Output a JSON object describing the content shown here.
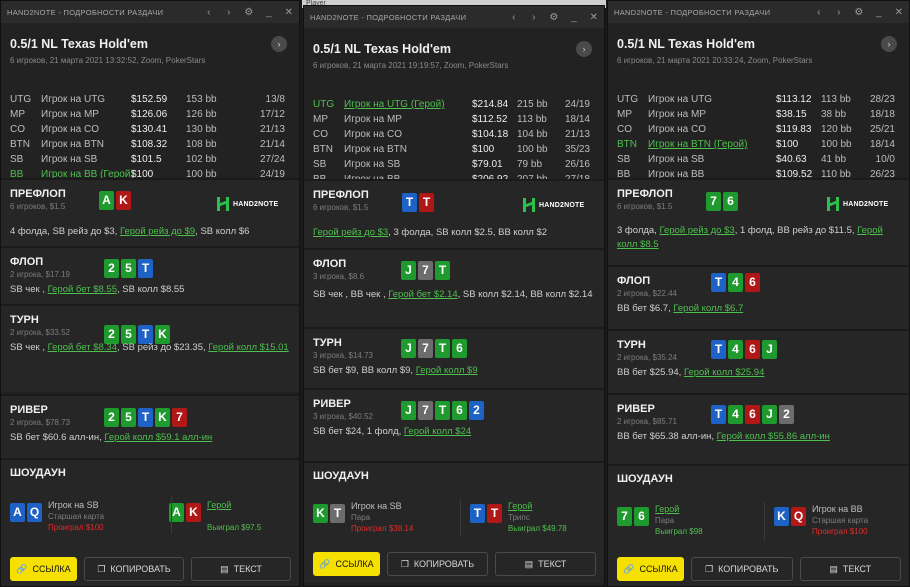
{
  "background_strip": {
    "text": "Player"
  },
  "common": {
    "window_title": "HAND2NOTE - ПОДРОБНОСТИ РАЗДАЧИ",
    "game_title": "0.5/1 NL Texas Hold'em",
    "logo_text": "HAND2NOTE",
    "showdown_title": "ШОУДАУН",
    "btn_link": "ССЫЛКА",
    "btn_copy": "КОПИРОВАТЬ",
    "btn_text": "ТЕКСТ"
  },
  "windows": [
    {
      "subtitle": "6 игроков, 21 марта 2021 13:32:52, Zoom, PokerStars",
      "players": [
        {
          "pos": "UTG",
          "name": "Игрок на UTG",
          "stack": "$152.59",
          "bb": "153 bb",
          "ratio": "13/8",
          "hero": false
        },
        {
          "pos": "MP",
          "name": "Игрок на MP",
          "stack": "$126.06",
          "bb": "126 bb",
          "ratio": "17/12",
          "hero": false
        },
        {
          "pos": "CO",
          "name": "Игрок на CO",
          "stack": "$130.41",
          "bb": "130 bb",
          "ratio": "21/13",
          "hero": false
        },
        {
          "pos": "BTN",
          "name": "Игрок на BTN",
          "stack": "$108.32",
          "bb": "108 bb",
          "ratio": "21/14",
          "hero": false
        },
        {
          "pos": "SB",
          "name": "Игрок на SB",
          "stack": "$101.5",
          "bb": "102 bb",
          "ratio": "27/24",
          "hero": false
        },
        {
          "pos": "BB",
          "name": "Игрок на BB (Герой)",
          "stack": "$100",
          "bb": "100 bb",
          "ratio": "24/19",
          "hero": true
        }
      ],
      "streets": [
        {
          "name": "ПРЕФЛОП",
          "info": "6 игроков, $1.5",
          "cards": [
            [
              "A",
              "g"
            ],
            [
              "K",
              "r"
            ]
          ],
          "actions": [
            [
              "4 фолда, SB рейз до $3, ",
              false
            ],
            [
              "Герой рейз до $9",
              true
            ],
            [
              ", SB колл $6",
              false
            ]
          ]
        },
        {
          "name": "ФЛОП",
          "info": "2 игрока, $17.19",
          "cards": [
            [
              "2",
              "g"
            ],
            [
              "5",
              "g"
            ],
            [
              "T",
              "b"
            ]
          ],
          "actions": [
            [
              "SB чек , ",
              false
            ],
            [
              "Герой бет $8.55",
              true
            ],
            [
              ", SB колл $8.55",
              false
            ]
          ]
        },
        {
          "name": "ТУРН",
          "info": "2 игрока, $33.52",
          "cards": [
            [
              "2",
              "g"
            ],
            [
              "5",
              "g"
            ],
            [
              "T",
              "b"
            ],
            [
              "K",
              "g"
            ]
          ],
          "actions": [
            [
              "SB чек , ",
              false
            ],
            [
              "Герой бет $8.34",
              true
            ],
            [
              ", SB рейз до $23.35, ",
              false
            ],
            [
              "Герой колл $15.01",
              true
            ]
          ]
        },
        {
          "name": "РИВЕР",
          "info": "2 игрока, $78.73",
          "cards": [
            [
              "2",
              "g"
            ],
            [
              "5",
              "g"
            ],
            [
              "T",
              "b"
            ],
            [
              "K",
              "g"
            ],
            [
              "7",
              "r"
            ]
          ],
          "actions": [
            [
              "SB бет $60.6 алл-ин, ",
              false
            ],
            [
              "Герой колл $59.1 алл-ин",
              true
            ]
          ]
        }
      ],
      "showdown": [
        {
          "cards": [
            [
              "A",
              "b"
            ],
            [
              "Q",
              "b"
            ]
          ],
          "who": "Игрок на SB",
          "hero": false,
          "hand": "Старшая карта",
          "result": "Проиграл $100",
          "win": false
        },
        {
          "cards": [
            [
              "A",
              "g"
            ],
            [
              "K",
              "r"
            ]
          ],
          "who": "Герой",
          "hero": true,
          "hand": "",
          "result": "Выиграл $97.5",
          "win": true
        }
      ]
    },
    {
      "subtitle": "6 игроков, 21 марта 2021 19:19:57, Zoom, PokerStars",
      "players": [
        {
          "pos": "UTG",
          "name": "Игрок на UTG (Герой)",
          "stack": "$214.84",
          "bb": "215 bb",
          "ratio": "24/19",
          "hero": true
        },
        {
          "pos": "MP",
          "name": "Игрок на MP",
          "stack": "$112.52",
          "bb": "113 bb",
          "ratio": "18/14",
          "hero": false
        },
        {
          "pos": "CO",
          "name": "Игрок на CO",
          "stack": "$104.18",
          "bb": "104 bb",
          "ratio": "21/13",
          "hero": false
        },
        {
          "pos": "BTN",
          "name": "Игрок на BTN",
          "stack": "$100",
          "bb": "100 bb",
          "ratio": "35/23",
          "hero": false
        },
        {
          "pos": "SB",
          "name": "Игрок на SB",
          "stack": "$79.01",
          "bb": "79 bb",
          "ratio": "26/16",
          "hero": false
        },
        {
          "pos": "BB",
          "name": "Игрок на BB",
          "stack": "$206.92",
          "bb": "207 bb",
          "ratio": "27/18",
          "hero": false
        }
      ],
      "streets": [
        {
          "name": "ПРЕФЛОП",
          "info": "6 игроков, $1.5",
          "cards": [
            [
              "T",
              "b"
            ],
            [
              "T",
              "r"
            ]
          ],
          "actions": [
            [
              "Герой рейз до $3",
              true
            ],
            [
              ", 3 фолда, SB колл $2.5, BB колл $2",
              false
            ]
          ]
        },
        {
          "name": "ФЛОП",
          "info": "3 игрока, $8.6",
          "cards": [
            [
              "J",
              "g"
            ],
            [
              "7",
              "x"
            ],
            [
              "T",
              "g"
            ]
          ],
          "actions": [
            [
              "SB чек , BB чек , ",
              false
            ],
            [
              "Герой бет $2.14",
              true
            ],
            [
              ", SB колл $2.14, BB колл $2.14",
              false
            ]
          ]
        },
        {
          "name": "ТУРН",
          "info": "3 игрока, $14.73",
          "cards": [
            [
              "J",
              "g"
            ],
            [
              "7",
              "x"
            ],
            [
              "T",
              "g"
            ],
            [
              "6",
              "g"
            ]
          ],
          "actions": [
            [
              "SB бет $9, BB колл $9, ",
              false
            ],
            [
              "Герой колл $9",
              true
            ]
          ]
        },
        {
          "name": "РИВЕР",
          "info": "3 игрока, $40.52",
          "cards": [
            [
              "J",
              "g"
            ],
            [
              "7",
              "x"
            ],
            [
              "T",
              "g"
            ],
            [
              "6",
              "g"
            ],
            [
              "2",
              "b"
            ]
          ],
          "actions": [
            [
              "SB бет $24, 1 фолд, ",
              false
            ],
            [
              "Герой колл $24",
              true
            ]
          ]
        }
      ],
      "showdown": [
        {
          "cards": [
            [
              "K",
              "g"
            ],
            [
              "T",
              "x"
            ]
          ],
          "who": "Игрок на SB",
          "hero": false,
          "hand": "Пара",
          "result": "Проиграл $38.14",
          "win": false
        },
        {
          "cards": [
            [
              "T",
              "b"
            ],
            [
              "T",
              "r"
            ]
          ],
          "who": "Герой",
          "hero": true,
          "hand": "Трипс",
          "result": "Выиграл $49.78",
          "win": true
        }
      ]
    },
    {
      "subtitle": "6 игроков, 21 марта 2021 20:33:24, Zoom, PokerStars",
      "players": [
        {
          "pos": "UTG",
          "name": "Игрок на UTG",
          "stack": "$113.12",
          "bb": "113 bb",
          "ratio": "28/23",
          "hero": false
        },
        {
          "pos": "MP",
          "name": "Игрок на MP",
          "stack": "$38.15",
          "bb": "38 bb",
          "ratio": "18/18",
          "hero": false
        },
        {
          "pos": "CO",
          "name": "Игрок на CO",
          "stack": "$119.83",
          "bb": "120 bb",
          "ratio": "25/21",
          "hero": false
        },
        {
          "pos": "BTN",
          "name": "Игрок на BTN (Герой)",
          "stack": "$100",
          "bb": "100 bb",
          "ratio": "18/14",
          "hero": true
        },
        {
          "pos": "SB",
          "name": "Игрок на SB",
          "stack": "$40.63",
          "bb": "41 bb",
          "ratio": "10/0",
          "hero": false
        },
        {
          "pos": "BB",
          "name": "Игрок на BB",
          "stack": "$109.52",
          "bb": "110 bb",
          "ratio": "26/23",
          "hero": false
        }
      ],
      "streets": [
        {
          "name": "ПРЕФЛОП",
          "info": "6 игроков, $1.5",
          "cards": [
            [
              "7",
              "g"
            ],
            [
              "6",
              "g"
            ]
          ],
          "actions": [
            [
              "3 фолда, ",
              false
            ],
            [
              "Герой рейз до $3",
              true
            ],
            [
              ", 1 фолд, BB рейз до $11.5, ",
              false
            ],
            [
              "Герой колл $8.5",
              true
            ]
          ]
        },
        {
          "name": "ФЛОП",
          "info": "2 игрока, $22.44",
          "cards": [
            [
              "T",
              "b"
            ],
            [
              "4",
              "g"
            ],
            [
              "6",
              "r"
            ]
          ],
          "actions": [
            [
              "BB бет $6.7, ",
              false
            ],
            [
              "Герой колл $6.7",
              true
            ]
          ]
        },
        {
          "name": "ТУРН",
          "info": "2 игрока, $35.24",
          "cards": [
            [
              "T",
              "b"
            ],
            [
              "4",
              "g"
            ],
            [
              "6",
              "r"
            ],
            [
              "J",
              "g"
            ]
          ],
          "actions": [
            [
              "BB бет $25.94, ",
              false
            ],
            [
              "Герой колл $25.94",
              true
            ]
          ]
        },
        {
          "name": "РИВЕР",
          "info": "2 игрока, $85.71",
          "cards": [
            [
              "T",
              "b"
            ],
            [
              "4",
              "g"
            ],
            [
              "6",
              "r"
            ],
            [
              "J",
              "g"
            ],
            [
              "2",
              "x"
            ]
          ],
          "actions": [
            [
              "BB бет $65.38 алл-ин, ",
              false
            ],
            [
              "Герой колл $55.86 алл-ин",
              true
            ]
          ]
        }
      ],
      "showdown": [
        {
          "cards": [
            [
              "7",
              "g"
            ],
            [
              "6",
              "g"
            ]
          ],
          "who": "Герой",
          "hero": true,
          "hand": "Пара",
          "result": "Выиграл $98",
          "win": true
        },
        {
          "cards": [
            [
              "K",
              "b"
            ],
            [
              "Q",
              "r"
            ]
          ],
          "who": "Игрок на BB",
          "hero": false,
          "hand": "Старшая карта",
          "result": "Проиграл $100",
          "win": false
        }
      ]
    }
  ]
}
